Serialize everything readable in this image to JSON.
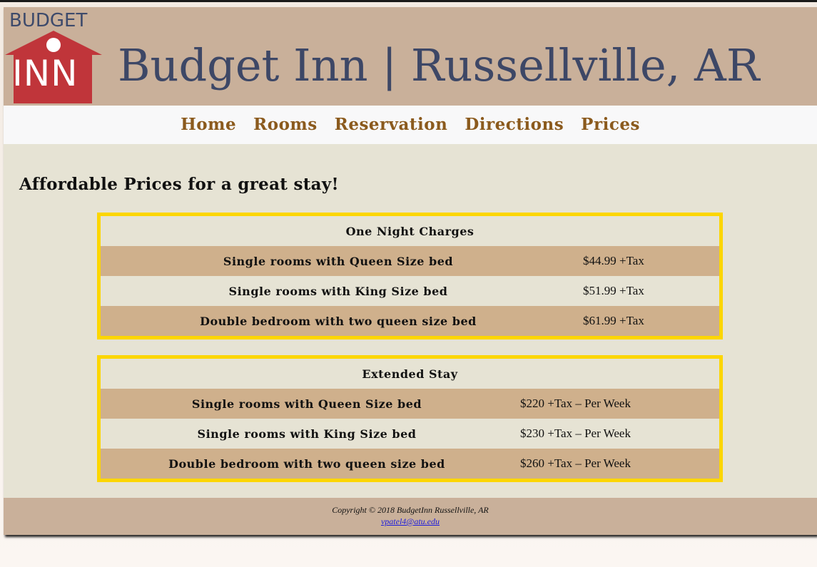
{
  "header": {
    "logo_top": "BUDGET",
    "logo_main": "INN",
    "title": "Budget Inn | Russellville, AR"
  },
  "nav": {
    "items": [
      "Home",
      "Rooms",
      "Reservation",
      "Directions",
      "Prices"
    ]
  },
  "main": {
    "heading": "Affordable Prices for a great stay!",
    "nightly": {
      "title": "One Night Charges",
      "rows": [
        {
          "room": "Single rooms with Queen Size bed",
          "price": "$44.99 +Tax"
        },
        {
          "room": "Single rooms with King Size bed",
          "price": "$51.99 +Tax"
        },
        {
          "room": "Double bedroom with two queen size bed",
          "price": "$61.99 +Tax"
        }
      ]
    },
    "extended": {
      "title": "Extended Stay",
      "rows": [
        {
          "room": "Single rooms with Queen Size bed",
          "price": "$220 +Tax – Per Week"
        },
        {
          "room": "Single rooms with King Size bed",
          "price": "$230 +Tax – Per Week"
        },
        {
          "room": "Double bedroom with two queen size bed",
          "price": "$260 +Tax – Per Week"
        }
      ]
    }
  },
  "footer": {
    "copyright": "Copyright © 2018 BudgetInn Russellville, AR",
    "email": "vpatel4@atu.edu"
  },
  "colors": {
    "header_bg": "#c9b09a",
    "title_text": "#3d4766",
    "nav_link": "#8b5a1d",
    "page_bg": "#e6e3d4",
    "table_border": "#fcd600",
    "shaded_row": "#cfb08c",
    "logo_red": "#c0353a"
  }
}
